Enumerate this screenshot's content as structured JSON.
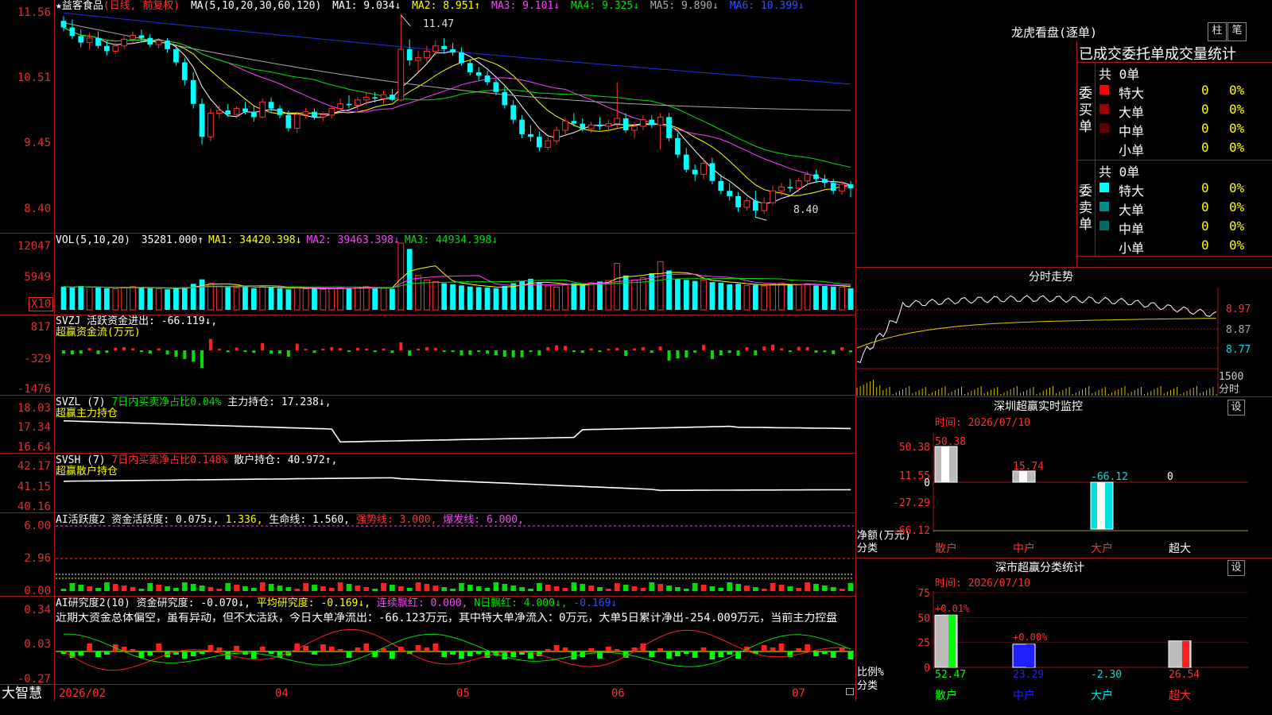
{
  "header": {
    "stock_name": "★益客食品",
    "period": "(日线, 前复权)",
    "ma_label": "MA(5,10,20,30,60,120)",
    "ma": [
      {
        "text": "MA1: 9.034↓",
        "color": "#ffffff"
      },
      {
        "text": "MA2: 8.951↑",
        "color": "#ffff00"
      },
      {
        "text": "MA3: 9.101↓",
        "color": "#ff40ff"
      },
      {
        "text": "MA4: 9.325↓",
        "color": "#00e000"
      },
      {
        "text": "MA5: 9.890↓",
        "color": "#aaaaaa"
      },
      {
        "text": "MA6: 10.399↓",
        "color": "#2020ff"
      }
    ]
  },
  "price_axis": {
    "ticks": [
      "11.56",
      "10.51",
      "9.45",
      "8.40"
    ]
  },
  "annotations": {
    "high": "11.47",
    "low": "8.40"
  },
  "vol_panel": {
    "title": "VOL(5,10,20)",
    "value": "35281.000↑",
    "ma1": "MA1: 34420.398↓",
    "ma2": "MA2: 39463.398↓",
    "ma3": "MA3: 44934.398↓",
    "ticks": [
      "12047",
      "5949"
    ],
    "unit": "X10"
  },
  "svzj_panel": {
    "line1": "SVZJ  活跃资金进出: -66.119↓,",
    "line2": "超赢资金流(万元)",
    "ticks": [
      "817",
      "-329",
      "-1476"
    ]
  },
  "svzl_panel": {
    "name": "SVZL (7)",
    "ratio": "7日内买卖净占比0.04%",
    "hold": "主力持仓: 17.238↓,",
    "line2": "超赢主力持仓",
    "ticks": [
      "18.03",
      "17.34",
      "16.64"
    ]
  },
  "svsh_panel": {
    "name": "SVSH (7)",
    "ratio": "7日内买卖净占比0.148%",
    "hold": "散户持仓: 40.972↑,",
    "line2": "超赢散户持仓",
    "ticks": [
      "42.17",
      "41.15",
      "40.16"
    ]
  },
  "ai1_panel": {
    "name": "AI活跃度2",
    "act": "资金活跃度: 0.075↓,",
    "v2": "1.336,",
    "life": "生命线: 1.560,",
    "strong": "强势线: 3.000,",
    "burst": "爆发线: 6.000,",
    "ticks": [
      "6.00",
      "2.96",
      "0.00"
    ]
  },
  "ai2_panel": {
    "name": "AI研究度2(10)",
    "research": "资金研究度: -0.070↓,",
    "avg": "平均研究度: -0.169↓,",
    "cont": "连续飘红: 0.000,",
    "nday": "N日飘红: 4.000↓,",
    "last": "-0.169↓",
    "desc": "近期大资金总体偏空，虽有异动，但不太活跃，今日大单净流出：-66.123万元，其中特大单净流入：0万元，大单5日累计净出-254.009万元，当前主力控盘",
    "ticks": [
      "0.34",
      "0.03",
      "-0.27"
    ]
  },
  "bottom": {
    "app": "大智慧",
    "dates": [
      "2026/02",
      "04",
      "05",
      "06",
      "07"
    ]
  },
  "lhb": {
    "title": "龙虎看盘(逐单)",
    "btn1": "柱",
    "btn2": "笔",
    "header": "已成交委托单成交量统计",
    "buy_label": "委买单",
    "sell_label": "委卖单",
    "buy_total": "共 0单",
    "sell_total": "共 0单",
    "buy_rows": [
      {
        "name": "特大",
        "v": "0",
        "p": "0%",
        "color": "#ff0000"
      },
      {
        "name": "大单",
        "v": "0",
        "p": "0%",
        "color": "#a00000"
      },
      {
        "name": "中单",
        "v": "0",
        "p": "0%",
        "color": "#600000"
      },
      {
        "name": "小单",
        "v": "0",
        "p": "0%",
        "color": ""
      }
    ],
    "sell_rows": [
      {
        "name": "特大",
        "v": "0",
        "p": "0%",
        "color": "#00ffff"
      },
      {
        "name": "大单",
        "v": "0",
        "p": "0%",
        "color": "#008c8c"
      },
      {
        "name": "中单",
        "v": "0",
        "p": "0%",
        "color": "#006a6a"
      },
      {
        "name": "小单",
        "v": "0",
        "p": "0%",
        "color": ""
      }
    ]
  },
  "intraday": {
    "title": "分时走势",
    "ticks": [
      "8.97",
      "8.87",
      "8.77"
    ],
    "vol_tick": "1500",
    "vol_unit": "分时"
  },
  "sz_monitor": {
    "title": "深圳超赢实时监控",
    "btn": "设",
    "date": "时间: 2026/07/10",
    "ticks": [
      "50.38",
      "11.55",
      "0",
      "-27.29",
      "-66.12"
    ],
    "ylabel1": "净额(万元)",
    "ylabel2": "分类",
    "cats": [
      "散户",
      "中户",
      "大户",
      "超大"
    ]
  },
  "sz_class": {
    "title": "深市超赢分类统计",
    "btn": "设",
    "date": "时间: 2026/07/10",
    "ticks": [
      "75",
      "50",
      "25",
      "0"
    ],
    "ylabel1": "比例%",
    "ylabel2": "分类",
    "cats": [
      "散户",
      "中户",
      "大户",
      "超大"
    ]
  },
  "chart_data": [
    {
      "type": "candlestick",
      "title": "益客食品 日线",
      "ylim": [
        8.2,
        11.6
      ],
      "candles_ohlc": [
        [
          11.38,
          11.45,
          11.22,
          11.28
        ],
        [
          11.28,
          11.4,
          11.1,
          11.15
        ],
        [
          11.15,
          11.25,
          10.98,
          11.05
        ],
        [
          11.05,
          11.2,
          10.95,
          11.12
        ],
        [
          11.12,
          11.22,
          10.96,
          11.0
        ],
        [
          11.0,
          11.08,
          10.85,
          10.92
        ],
        [
          10.92,
          11.05,
          10.88,
          11.0
        ],
        [
          11.0,
          11.15,
          10.95,
          11.1
        ],
        [
          11.1,
          11.22,
          11.04,
          11.16
        ],
        [
          11.16,
          11.25,
          11.06,
          11.12
        ],
        [
          11.12,
          11.18,
          10.98,
          11.02
        ],
        [
          11.02,
          11.12,
          10.96,
          11.08
        ],
        [
          11.08,
          11.12,
          10.9,
          10.95
        ],
        [
          10.95,
          11.02,
          10.7,
          10.75
        ],
        [
          10.75,
          10.82,
          10.4,
          10.48
        ],
        [
          10.48,
          10.6,
          10.05,
          10.12
        ],
        [
          10.12,
          10.2,
          9.5,
          9.62
        ],
        [
          9.62,
          10.05,
          9.55,
          9.98
        ],
        [
          9.98,
          10.1,
          9.9,
          10.02
        ],
        [
          10.02,
          10.12,
          9.92,
          9.96
        ],
        [
          9.96,
          10.08,
          9.9,
          10.05
        ],
        [
          10.05,
          10.15,
          9.96,
          10.0
        ],
        [
          10.0,
          10.1,
          9.85,
          9.92
        ],
        [
          9.92,
          10.2,
          9.9,
          10.15
        ],
        [
          10.15,
          10.22,
          10.0,
          10.05
        ],
        [
          10.05,
          10.1,
          9.9,
          9.95
        ],
        [
          9.95,
          10.02,
          9.7,
          9.75
        ],
        [
          9.75,
          10.0,
          9.68,
          9.96
        ],
        [
          9.96,
          10.06,
          9.9,
          10.0
        ],
        [
          10.0,
          10.05,
          9.88,
          9.92
        ],
        [
          9.92,
          10.0,
          9.85,
          9.95
        ],
        [
          9.95,
          10.08,
          9.9,
          10.05
        ],
        [
          10.05,
          10.2,
          10.0,
          10.12
        ],
        [
          10.12,
          10.25,
          10.05,
          10.1
        ],
        [
          10.1,
          10.22,
          10.02,
          10.18
        ],
        [
          10.18,
          10.3,
          10.1,
          10.22
        ],
        [
          10.22,
          10.3,
          10.14,
          10.2
        ],
        [
          10.2,
          10.32,
          10.12,
          10.26
        ],
        [
          10.26,
          10.35,
          10.16,
          10.18
        ],
        [
          10.18,
          11.47,
          10.15,
          10.95
        ],
        [
          10.95,
          11.1,
          10.7,
          10.78
        ],
        [
          10.78,
          10.92,
          10.6,
          10.82
        ],
        [
          10.82,
          11.0,
          10.75,
          10.92
        ],
        [
          10.92,
          11.08,
          10.85,
          11.0
        ],
        [
          11.0,
          11.12,
          10.88,
          10.95
        ],
        [
          10.95,
          11.05,
          10.85,
          10.9
        ],
        [
          10.9,
          10.98,
          10.7,
          10.74
        ],
        [
          10.74,
          10.8,
          10.55,
          10.6
        ],
        [
          10.6,
          10.68,
          10.48,
          10.55
        ],
        [
          10.55,
          10.62,
          10.4,
          10.45
        ],
        [
          10.45,
          10.5,
          10.25,
          10.3
        ],
        [
          10.3,
          10.38,
          10.05,
          10.1
        ],
        [
          10.1,
          10.18,
          9.82,
          9.88
        ],
        [
          9.88,
          9.95,
          9.6,
          9.66
        ],
        [
          9.66,
          9.8,
          9.55,
          9.62
        ],
        [
          9.62,
          9.7,
          9.4,
          9.46
        ],
        [
          9.46,
          9.62,
          9.42,
          9.56
        ],
        [
          9.56,
          9.78,
          9.5,
          9.72
        ],
        [
          9.72,
          9.9,
          9.66,
          9.86
        ],
        [
          9.86,
          9.98,
          9.78,
          9.82
        ],
        [
          9.82,
          9.9,
          9.7,
          9.74
        ],
        [
          9.74,
          9.85,
          9.68,
          9.8
        ],
        [
          9.8,
          9.92,
          9.72,
          9.78
        ],
        [
          9.78,
          9.88,
          9.7,
          9.82
        ],
        [
          9.82,
          10.45,
          9.75,
          9.9
        ],
        [
          9.9,
          9.98,
          9.68,
          9.72
        ],
        [
          9.72,
          9.85,
          9.6,
          9.78
        ],
        [
          9.78,
          9.95,
          9.72,
          9.88
        ],
        [
          9.88,
          9.95,
          9.75,
          9.8
        ],
        [
          9.8,
          9.98,
          9.42,
          9.92
        ],
        [
          9.92,
          9.98,
          9.55,
          9.6
        ],
        [
          9.6,
          9.68,
          9.3,
          9.35
        ],
        [
          9.35,
          9.45,
          9.08,
          9.12
        ],
        [
          9.12,
          9.2,
          8.95,
          9.05
        ],
        [
          9.05,
          9.3,
          8.98,
          9.22
        ],
        [
          9.22,
          9.3,
          8.9,
          8.95
        ],
        [
          8.95,
          9.05,
          8.75,
          8.8
        ],
        [
          8.8,
          8.92,
          8.65,
          8.72
        ],
        [
          8.72,
          8.78,
          8.48,
          8.55
        ],
        [
          8.55,
          8.7,
          8.5,
          8.65
        ],
        [
          8.65,
          8.8,
          8.4,
          8.5
        ],
        [
          8.5,
          8.7,
          8.45,
          8.62
        ],
        [
          8.62,
          8.88,
          8.58,
          8.8
        ],
        [
          8.8,
          8.92,
          8.72,
          8.86
        ],
        [
          8.86,
          8.98,
          8.78,
          8.84
        ],
        [
          8.84,
          9.0,
          8.78,
          8.95
        ],
        [
          8.95,
          9.1,
          8.88,
          9.05
        ],
        [
          9.05,
          9.12,
          8.92,
          8.98
        ],
        [
          8.98,
          9.05,
          8.85,
          8.92
        ],
        [
          8.92,
          8.98,
          8.75,
          8.8
        ],
        [
          8.8,
          8.95,
          8.74,
          8.9
        ],
        [
          8.9,
          8.95,
          8.7,
          8.84
        ]
      ]
    },
    {
      "type": "bar",
      "title": "VOL(5,10,20)",
      "ylim": [
        0,
        12047
      ],
      "values": [
        4200,
        4000,
        4300,
        4100,
        4000,
        3900,
        3800,
        4100,
        4200,
        4000,
        3900,
        3800,
        3700,
        3900,
        4100,
        4700,
        5500,
        4800,
        4300,
        4100,
        4000,
        4200,
        3900,
        4300,
        4000,
        3900,
        3700,
        4100,
        3800,
        3900,
        3700,
        3800,
        4000,
        3900,
        4100,
        4200,
        4000,
        3900,
        3800,
        12047,
        11000,
        6200,
        5400,
        5100,
        4800,
        4600,
        4400,
        4200,
        4100,
        4000,
        3900,
        4300,
        4800,
        5200,
        5600,
        4900,
        4300,
        4100,
        4500,
        4800,
        4700,
        4900,
        5100,
        5300,
        8400,
        6200,
        5400,
        5800,
        6600,
        8700,
        7100,
        5600,
        5400,
        5200,
        5400,
        5000,
        4900,
        4600,
        4700,
        4400,
        4500,
        4300,
        4600,
        4800,
        4600,
        4500,
        4700,
        4400,
        4300,
        4200,
        4100,
        3900
      ]
    }
  ]
}
